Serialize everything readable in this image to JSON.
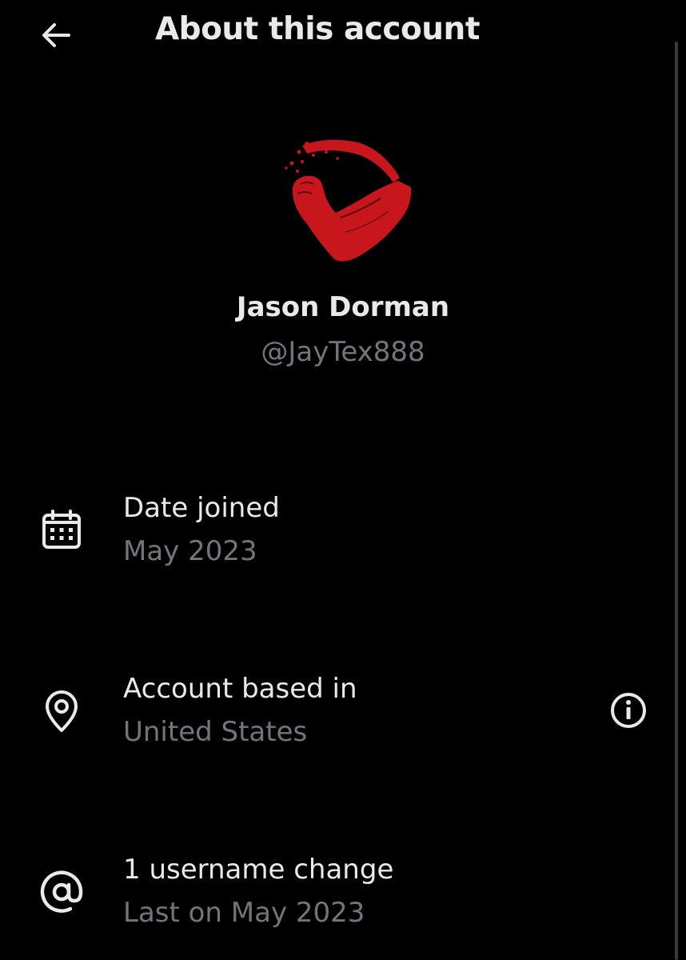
{
  "header": {
    "title": "About this account",
    "back_icon": "arrow-left-icon"
  },
  "profile": {
    "avatar_icon": "flexed-arm-logo",
    "avatar_color": "#c8161d",
    "display_name": "Jason Dorman",
    "handle": "@JayTex888"
  },
  "rows": [
    {
      "icon": "calendar-icon",
      "label": "Date joined",
      "value": "May 2023"
    },
    {
      "icon": "location-pin-icon",
      "label": "Account based in",
      "value": "United States",
      "action_icon": "info-icon"
    },
    {
      "icon": "at-sign-icon",
      "label": "1 username change",
      "value": "Last on May 2023"
    }
  ],
  "colors": {
    "background": "#000000",
    "primary_text": "#e7e9ea",
    "secondary_text": "#71767b"
  }
}
